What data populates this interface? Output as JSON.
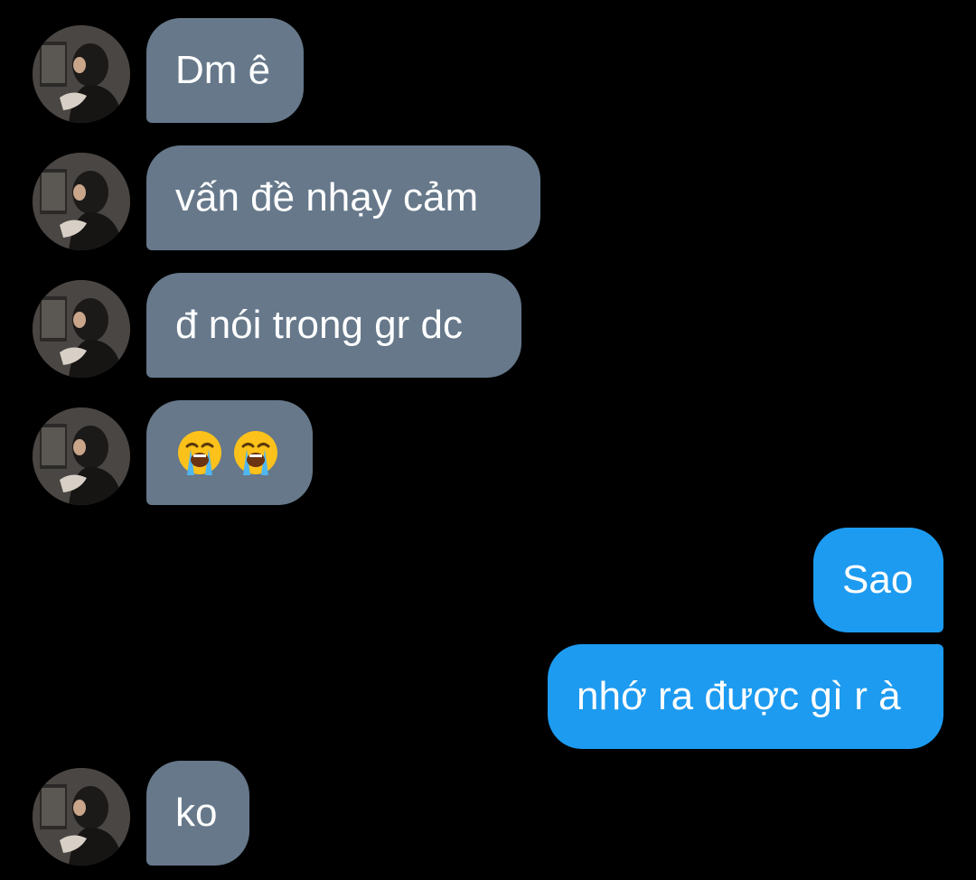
{
  "messages": [
    {
      "side": "incoming",
      "text": "Dm ê"
    },
    {
      "side": "incoming",
      "text": "vấn đề nhạy cảm"
    },
    {
      "side": "incoming",
      "text": "đ nói trong gr dc"
    },
    {
      "side": "incoming",
      "emoji": [
        "loudly-crying-face",
        "loudly-crying-face"
      ]
    },
    {
      "side": "outgoing",
      "text": "Sao"
    },
    {
      "side": "outgoing",
      "text": "nhớ ra được gì r à"
    },
    {
      "side": "incoming",
      "text": "ko"
    }
  ],
  "colors": {
    "background": "#000000",
    "incoming_bubble": "#66788a",
    "outgoing_bubble": "#1d9bf0",
    "text": "#ffffff"
  }
}
